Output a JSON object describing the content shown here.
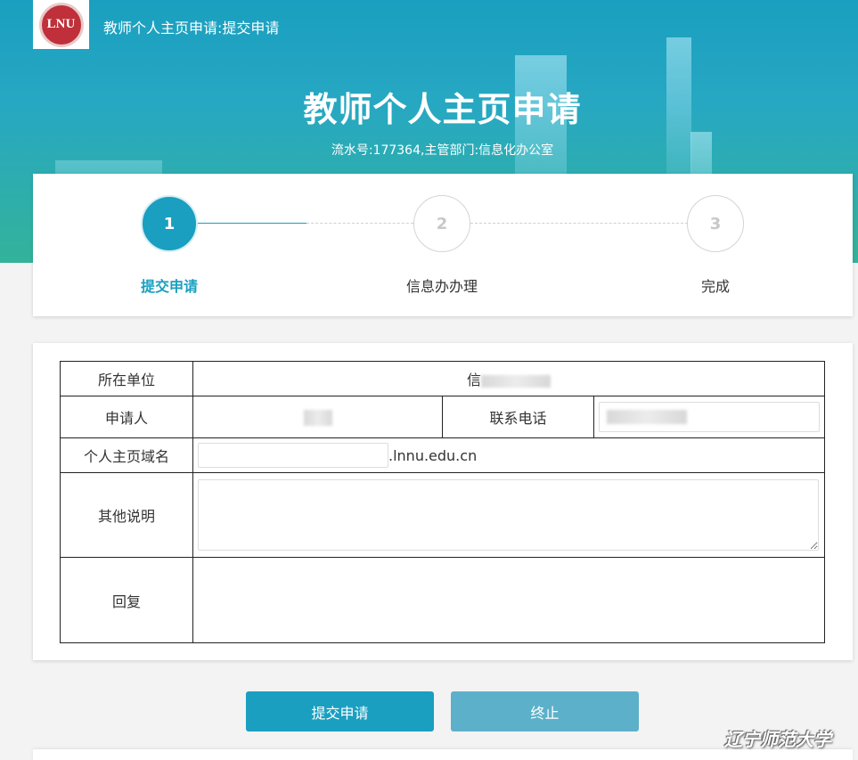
{
  "header": {
    "logo_text": "LNU",
    "top_title": "教师个人主页申请:提交申请",
    "main_title": "教师个人主页申请",
    "serial_info": "流水号:177364,主管部门:信息化办公室"
  },
  "steps": [
    {
      "number": "1",
      "label": "提交申请",
      "state": "active"
    },
    {
      "number": "2",
      "label": "信息办办理",
      "state": "pending"
    },
    {
      "number": "3",
      "label": "完成",
      "state": "pending"
    }
  ],
  "form": {
    "unit_label": "所在单位",
    "unit_value": "信",
    "applicant_label": "申请人",
    "phone_label": "联系电话",
    "domain_label": "个人主页域名",
    "domain_suffix": ".lnnu.edu.cn",
    "notes_label": "其他说明",
    "reply_label": "回复"
  },
  "buttons": {
    "submit": "提交申请",
    "stop": "终止"
  },
  "watermark": "辽宁师范大学",
  "colors": {
    "accent": "#1a9fc0",
    "stop_button": "#5db0c9"
  }
}
